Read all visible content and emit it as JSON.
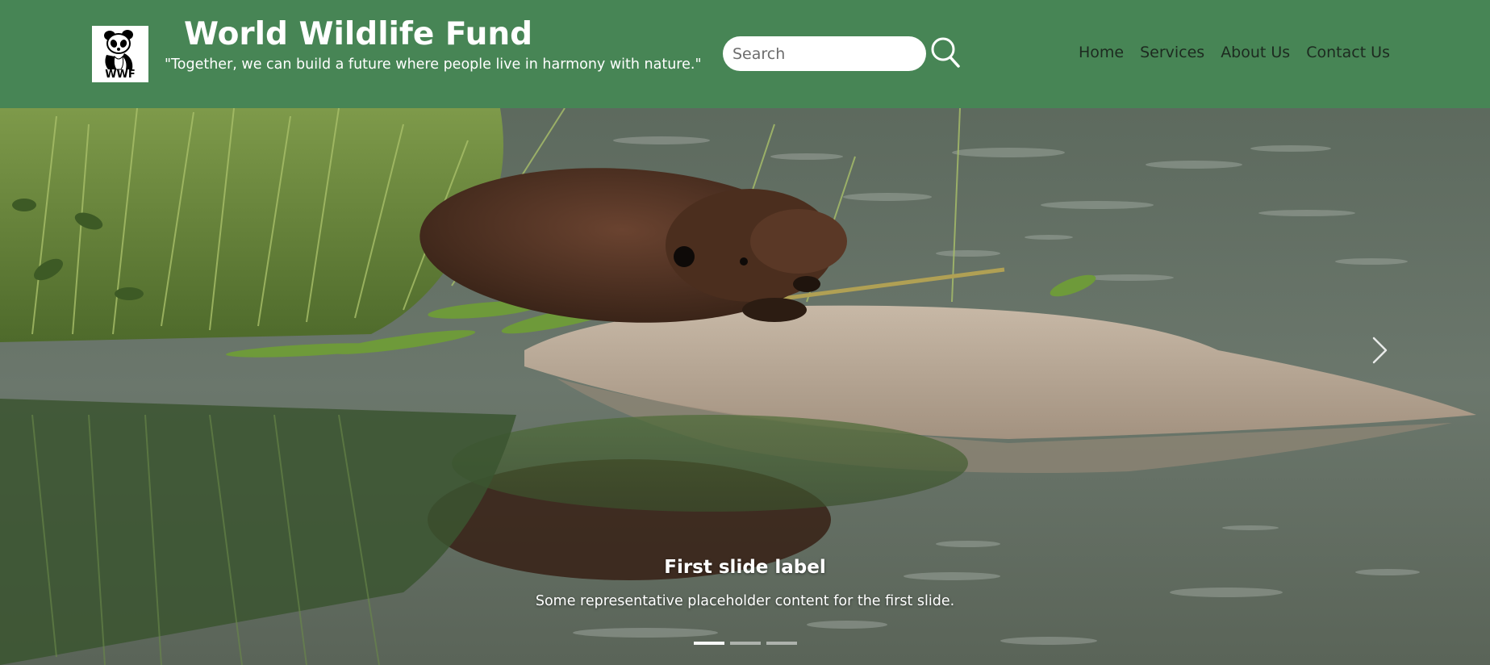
{
  "header": {
    "logo_text": "WWF",
    "title": "World Wildlife Fund",
    "tagline": "\"Together, we can build a future where people live in harmony with nature.\"",
    "background_color": "#478555"
  },
  "search": {
    "placeholder": "Search",
    "value": "",
    "icon": "search-icon"
  },
  "nav": {
    "items": [
      {
        "label": "Home"
      },
      {
        "label": "Services"
      },
      {
        "label": "About Us"
      },
      {
        "label": "Contact Us"
      }
    ]
  },
  "carousel": {
    "slide_title": "First slide label",
    "slide_text": "Some representative placeholder content for the first slide.",
    "next_icon": "chevron-right-icon",
    "indicators": [
      {
        "active": true
      },
      {
        "active": false
      },
      {
        "active": false
      }
    ],
    "image_subject": "beaver-on-rock-photo"
  }
}
